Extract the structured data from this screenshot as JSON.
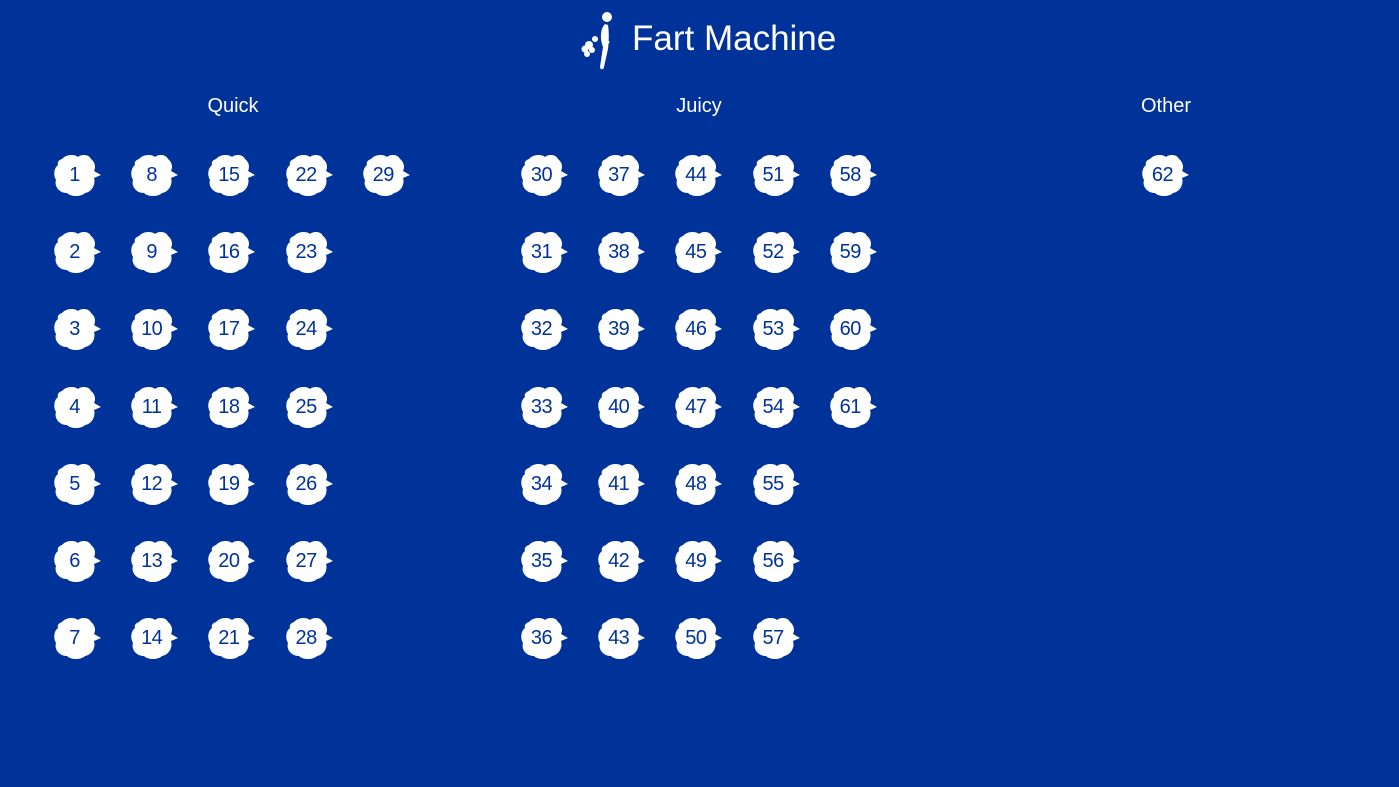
{
  "app": {
    "title": "Fart Machine",
    "icon": "person-farting-icon",
    "background_color": "#00339a",
    "tile_color": "#ffffff",
    "tile_text_color": "#00339a"
  },
  "groups": [
    {
      "title": "Quick",
      "columns": [
        [
          "1",
          "2",
          "3",
          "4",
          "5",
          "6",
          "7"
        ],
        [
          "8",
          "9",
          "10",
          "11",
          "12",
          "13",
          "14"
        ],
        [
          "15",
          "16",
          "17",
          "18",
          "19",
          "20",
          "21"
        ],
        [
          "22",
          "23",
          "24",
          "25",
          "26",
          "27",
          "28"
        ],
        [
          "29"
        ]
      ]
    },
    {
      "title": "Juicy",
      "columns": [
        [
          "30",
          "31",
          "32",
          "33",
          "34",
          "35",
          "36"
        ],
        [
          "37",
          "38",
          "39",
          "40",
          "41",
          "42",
          "43"
        ],
        [
          "44",
          "45",
          "46",
          "47",
          "48",
          "49",
          "50"
        ],
        [
          "51",
          "52",
          "53",
          "54",
          "55",
          "56",
          "57"
        ],
        [
          "58",
          "59",
          "60",
          "61"
        ]
      ]
    },
    {
      "title": "Other",
      "columns": [
        [
          "62"
        ]
      ]
    }
  ]
}
